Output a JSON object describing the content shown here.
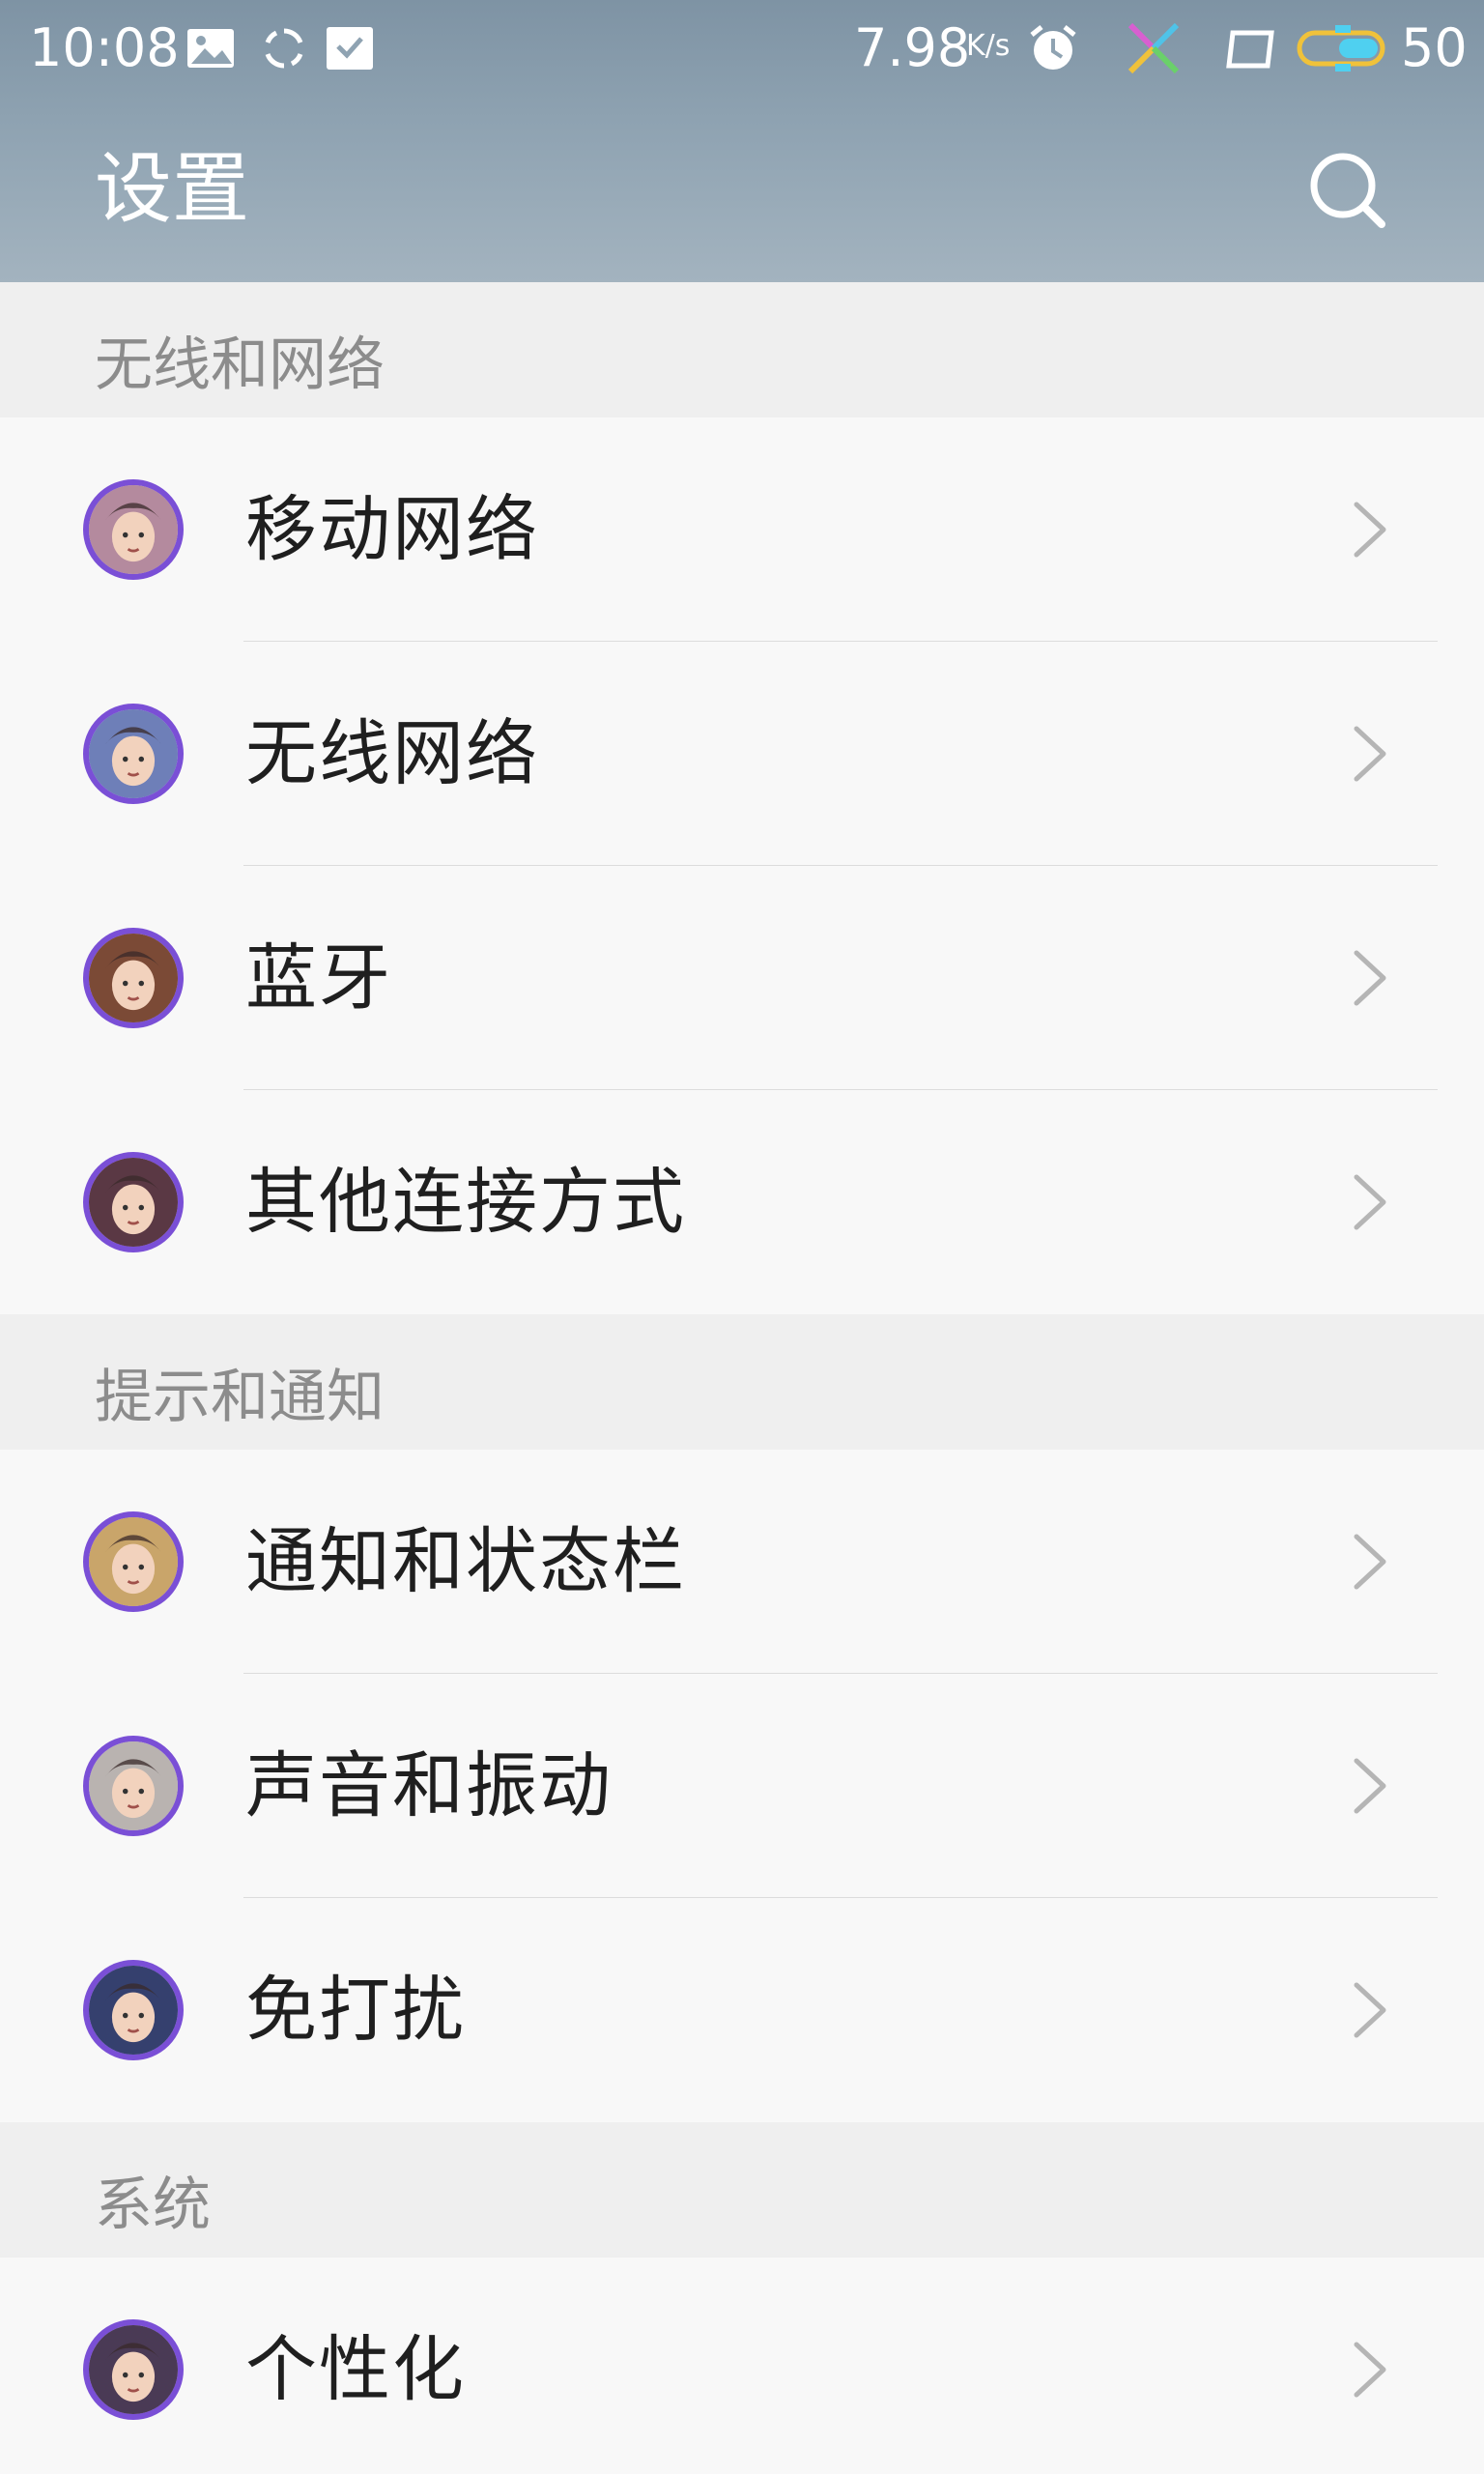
{
  "status_bar": {
    "time": "10:08",
    "net_speed": "7.98",
    "net_speed_unit": "K/s",
    "battery_level": "50",
    "icons": [
      "image-icon",
      "sync-icon",
      "inbox-check-icon",
      "alarm-icon",
      "app-pinwheel-icon",
      "screen-icon",
      "battery-icon"
    ]
  },
  "header": {
    "title": "设置",
    "search_icon": "search-icon"
  },
  "sections": [
    {
      "title": "无线和网络",
      "items": [
        {
          "label": "移动网络",
          "avatar_color": "#b48a9e"
        },
        {
          "label": "无线网络",
          "avatar_color": "#6e7fb8"
        },
        {
          "label": "蓝牙",
          "avatar_color": "#7b4a36"
        },
        {
          "label": "其他连接方式",
          "avatar_color": "#5a3844"
        }
      ]
    },
    {
      "title": "提示和通知",
      "items": [
        {
          "label": "通知和状态栏",
          "avatar_color": "#c9a56a"
        },
        {
          "label": "声音和振动",
          "avatar_color": "#b9b3b0"
        },
        {
          "label": "免打扰",
          "avatar_color": "#35406e"
        }
      ]
    },
    {
      "title": "系统",
      "items": [
        {
          "label": "个性化",
          "avatar_color": "#4a3a55"
        }
      ]
    }
  ],
  "colors": {
    "header_gradient_top": "#7e93a4",
    "header_gradient_bottom": "#a3b3bf",
    "section_bg": "#efefef",
    "row_bg": "#f8f8f8",
    "avatar_ring": "#7a4fd6",
    "chevron": "#b5b5b5"
  }
}
